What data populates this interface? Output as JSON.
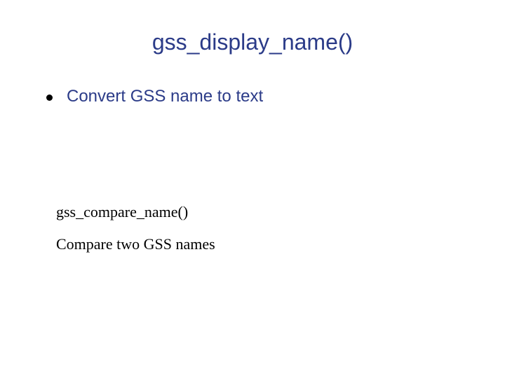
{
  "slide": {
    "title": "gss_display_name()",
    "bullet1": "Convert GSS name to text",
    "subheading": "gss_compare_name()",
    "subtext": "Compare two GSS names"
  }
}
